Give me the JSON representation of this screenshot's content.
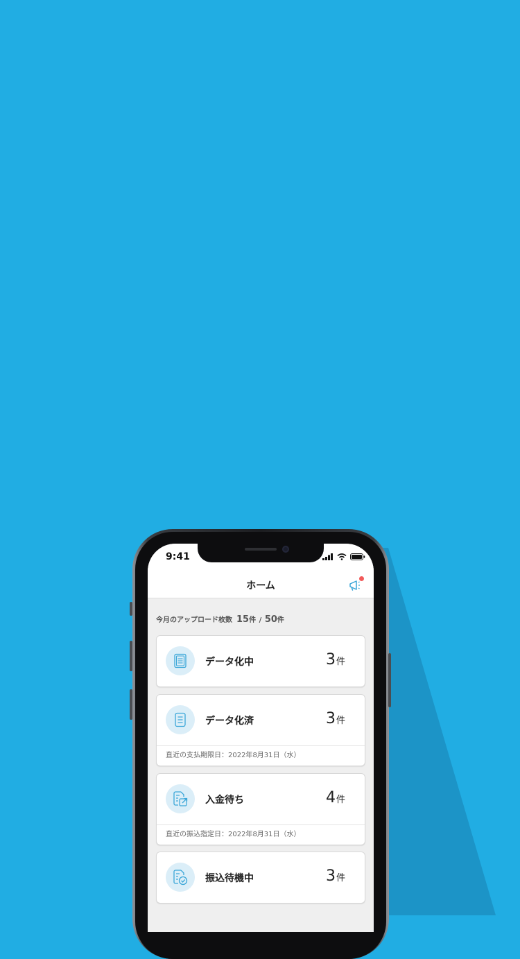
{
  "status_bar": {
    "time": "9:41"
  },
  "nav": {
    "title": "ホーム",
    "notification_icon": "megaphone-icon",
    "badge_color": "#f25a5a"
  },
  "upload": {
    "label": "今月のアップロード枚数",
    "count": "15",
    "unit": "件",
    "separator": "/",
    "limit": "50"
  },
  "cards": [
    {
      "label": "データ化中",
      "count": "3",
      "unit": "件",
      "icon": "document-processing-icon"
    },
    {
      "label": "データ化済",
      "count": "3",
      "unit": "件",
      "icon": "document-icon",
      "footer": "直近の支払期限日：2022年8月31日（水）"
    },
    {
      "label": "入金待ち",
      "count": "4",
      "unit": "件",
      "icon": "document-export-icon",
      "footer": "直近の振込指定日：2022年8月31日（水）"
    },
    {
      "label": "振込待機中",
      "count": "3",
      "unit": "件",
      "icon": "document-check-icon"
    }
  ],
  "colors": {
    "background": "#21ade3",
    "accent": "#3aa6d8",
    "icon_circle": "#dbeef8"
  }
}
